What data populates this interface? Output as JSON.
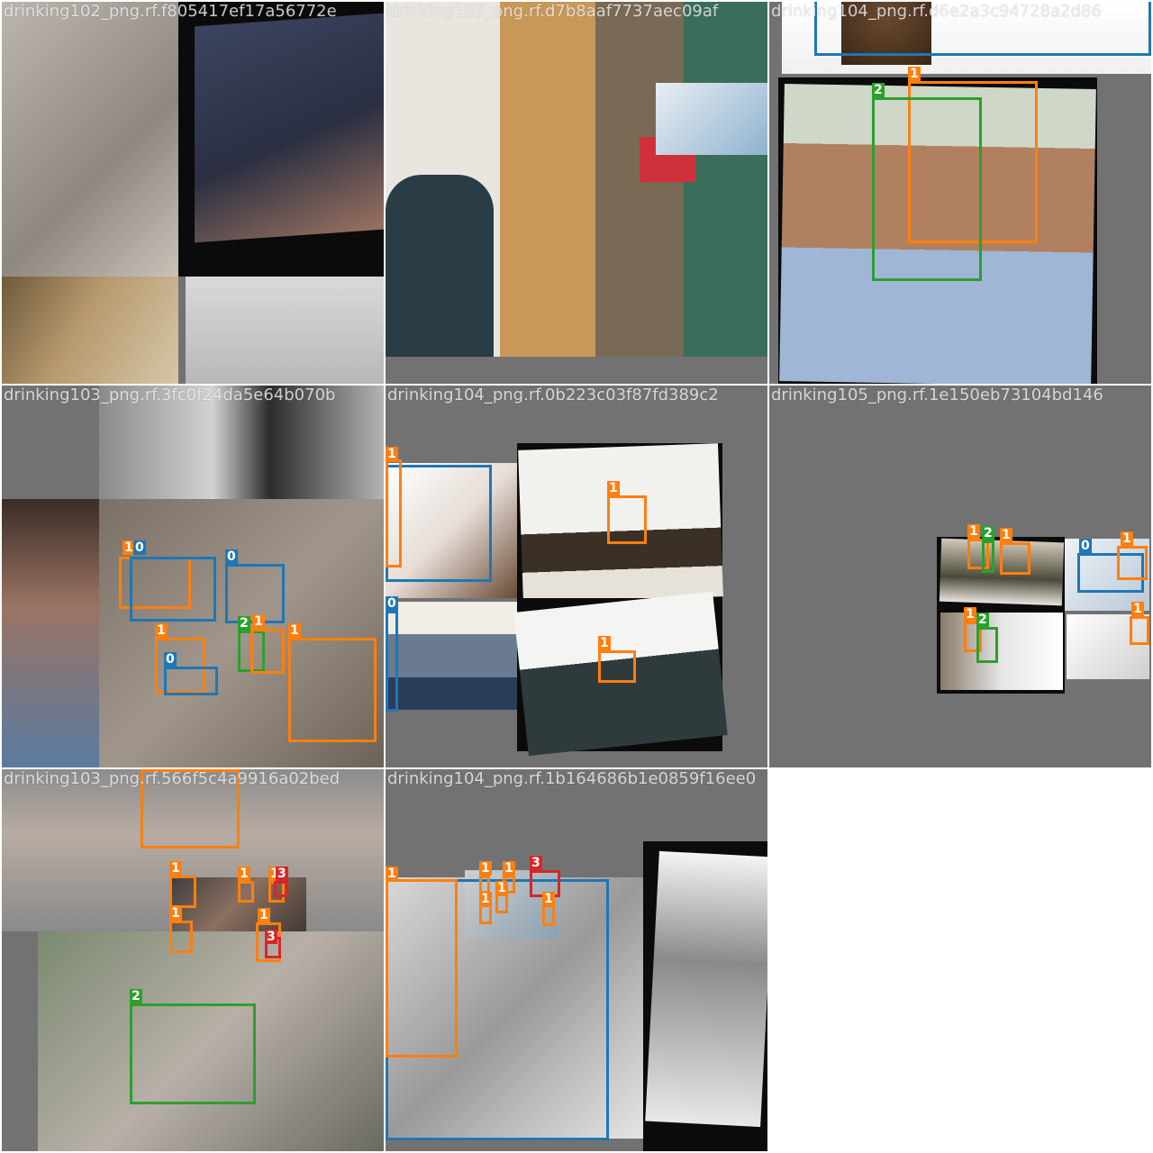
{
  "mosaic": {
    "tiles": [
      {
        "filename": "drinking102_png.rf.f805417ef17a56772e",
        "boxes": []
      },
      {
        "filename": "drinking103_png.rf.d7b8aaf7737aec09af",
        "boxes": []
      },
      {
        "filename": "drinking104_png.rf.d6e2a3c94728a2d86",
        "boxes": [
          {
            "label": "1"
          },
          {
            "label": "2"
          }
        ]
      },
      {
        "filename": "drinking103_png.rf.3fc0f24da5e64b070b",
        "boxes": [
          {
            "label": "1"
          },
          {
            "label": "0"
          },
          {
            "label": "0"
          },
          {
            "label": "1"
          },
          {
            "label": "0"
          },
          {
            "label": "2"
          },
          {
            "label": "1"
          },
          {
            "label": "1"
          }
        ]
      },
      {
        "filename": "drinking104_png.rf.0b223c03f87fd389c2",
        "boxes": [
          {
            "label": "1"
          },
          {
            "label": "1"
          },
          {
            "label": "1"
          },
          {
            "label": "0"
          }
        ]
      },
      {
        "filename": "drinking105_png.rf.1e150eb73104bd146",
        "boxes": [
          {
            "label": "1"
          },
          {
            "label": "2"
          },
          {
            "label": "1"
          },
          {
            "label": "0"
          },
          {
            "label": "1"
          },
          {
            "label": "1"
          },
          {
            "label": "1"
          },
          {
            "label": "2"
          }
        ]
      },
      {
        "filename": "drinking103_png.rf.566f5c4a9916a02bed",
        "boxes": [
          {
            "label": "1"
          },
          {
            "label": "1"
          },
          {
            "label": "1"
          },
          {
            "label": "1"
          },
          {
            "label": "3"
          },
          {
            "label": "1"
          },
          {
            "label": "1"
          },
          {
            "label": "3"
          },
          {
            "label": "2"
          }
        ]
      },
      {
        "filename": "drinking104_png.rf.1b164686b1e0859f16ee0",
        "boxes": [
          {
            "label": "1"
          },
          {
            "label": "1"
          },
          {
            "label": "1"
          },
          {
            "label": "3"
          },
          {
            "label": "1"
          },
          {
            "label": "1"
          },
          {
            "label": "1"
          }
        ]
      }
    ]
  },
  "colors": {
    "class_0": "#1f77b4",
    "class_1": "#ff7f0e",
    "class_2": "#2ca02c",
    "class_3": "#d62728",
    "pad_gray": "#727272"
  }
}
